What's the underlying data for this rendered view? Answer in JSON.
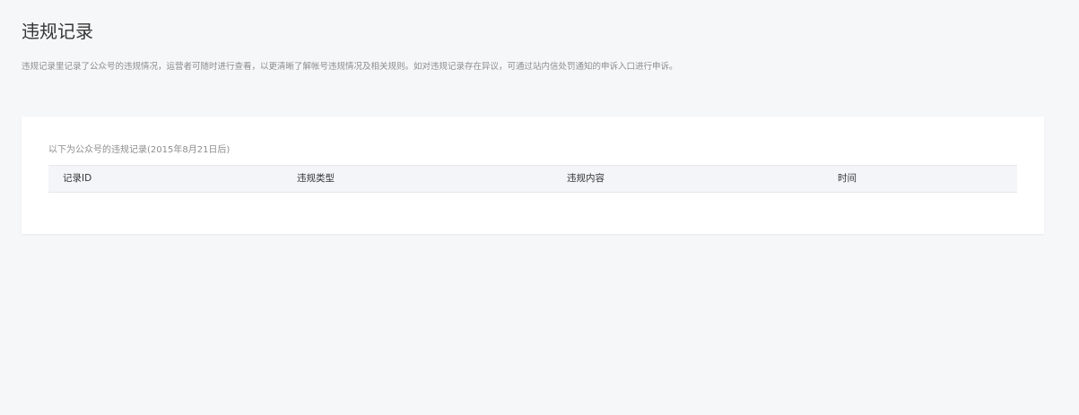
{
  "page": {
    "title": "违规记录",
    "description": "违规记录里记录了公众号的违规情况，运营者可随时进行查看，以更清晰了解帐号违规情况及相关规则。如对违规记录存在异议，可通过站内信处罚通知的申诉入口进行申诉。"
  },
  "records": {
    "caption": "以下为公众号的违规记录(2015年8月21日后)",
    "columns": [
      "记录ID",
      "违规类型",
      "违规内容",
      "时间"
    ],
    "rows": []
  }
}
